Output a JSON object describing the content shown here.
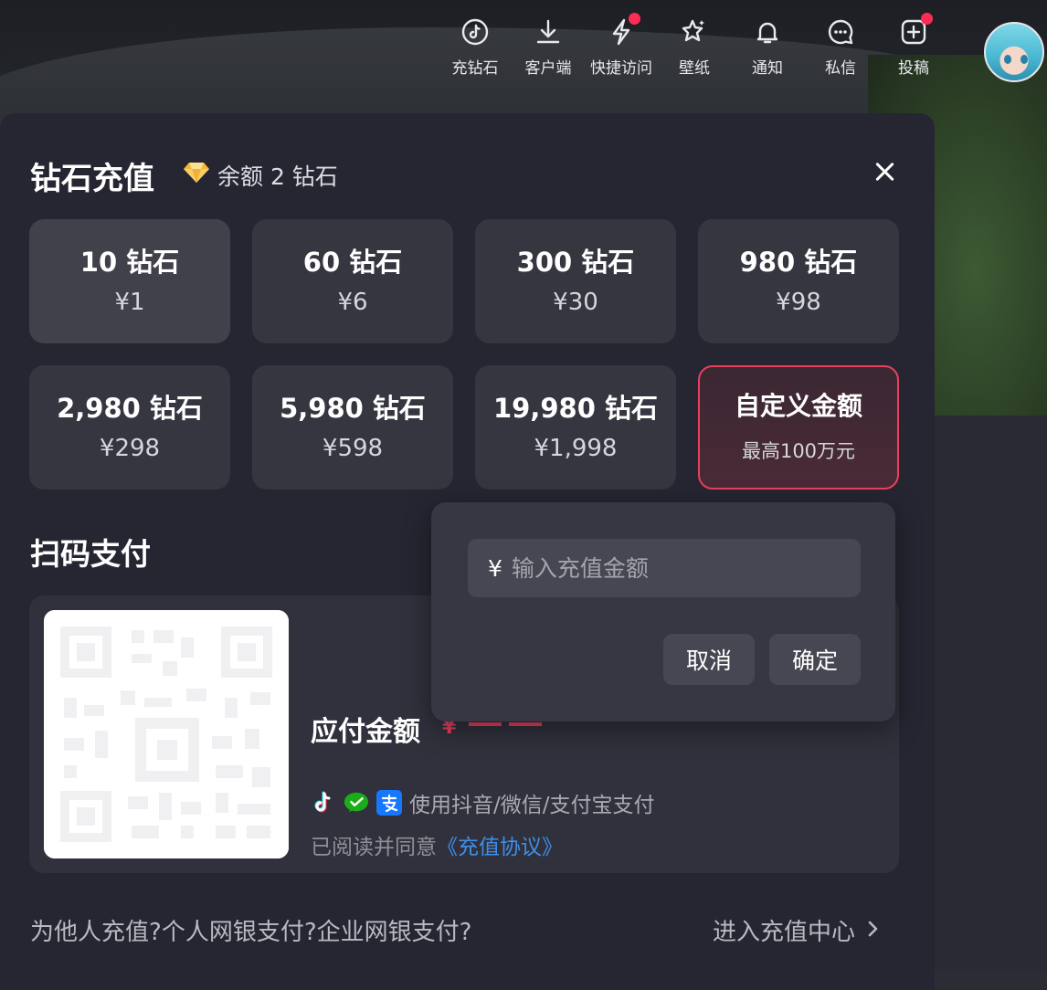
{
  "topnav": [
    {
      "label": "充钻石",
      "icon": "tiktok-coin-icon",
      "dot": false
    },
    {
      "label": "客户端",
      "icon": "download-icon",
      "dot": false
    },
    {
      "label": "快捷访问",
      "icon": "lightning-icon",
      "dot": true
    },
    {
      "label": "壁纸",
      "icon": "wallpaper-star-icon",
      "dot": false
    },
    {
      "label": "通知",
      "icon": "bell-icon",
      "dot": false
    },
    {
      "label": "私信",
      "icon": "message-icon",
      "dot": false
    },
    {
      "label": "投稿",
      "icon": "add-post-icon",
      "dot": true
    }
  ],
  "modal": {
    "title": "钻石充值",
    "balance_icon": "diamond-icon",
    "balance_text": "余额 2 钻石",
    "tiles": [
      {
        "amount": "10 钻石",
        "price": "¥1",
        "selected": true
      },
      {
        "amount": "60 钻石",
        "price": "¥6"
      },
      {
        "amount": "300 钻石",
        "price": "¥30"
      },
      {
        "amount": "980 钻石",
        "price": "¥98"
      },
      {
        "amount": "2,980 钻石",
        "price": "¥298"
      },
      {
        "amount": "5,980 钻石",
        "price": "¥598"
      },
      {
        "amount": "19,980 钻石",
        "price": "¥1,998"
      },
      {
        "amount": "自定义金额",
        "price": "最高100万元",
        "custom": true
      }
    ],
    "scan_title": "扫码支付",
    "amount_label": "应付金额",
    "amount_currency": "¥",
    "pay_methods_text": "使用抖音/微信/支付宝支付",
    "agree_text": "已阅读并同意",
    "agree_link": "《充值协议》",
    "footer_links": [
      "为他人充值?",
      "个人网银支付?",
      "企业网银支付?"
    ],
    "footer_right": "进入充值中心"
  },
  "popover": {
    "currency": "¥",
    "placeholder": "输入充值金额",
    "cancel": "取消",
    "confirm": "确定"
  },
  "colors": {
    "accent": "#fe2c55",
    "custom_border": "#e8405e",
    "link": "#3f8ee8",
    "panel": "#252632",
    "tile": "#35363f"
  }
}
